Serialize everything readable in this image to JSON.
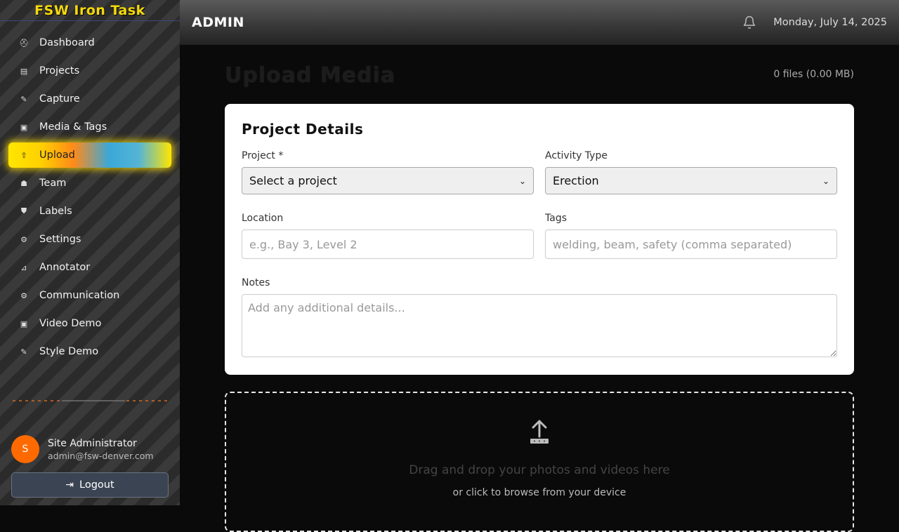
{
  "app": {
    "brand": "FSW Iron Task"
  },
  "sidebar": {
    "items": [
      {
        "label": "Dashboard",
        "icon": "helmet-icon",
        "glyph": "⛑"
      },
      {
        "label": "Projects",
        "icon": "folder-icon",
        "glyph": "▤"
      },
      {
        "label": "Capture",
        "icon": "pencil-icon",
        "glyph": "✎"
      },
      {
        "label": "Media & Tags",
        "icon": "image-icon",
        "glyph": "▣"
      },
      {
        "label": "Upload",
        "icon": "upload-icon",
        "glyph": "⇧"
      },
      {
        "label": "Team",
        "icon": "team-icon",
        "glyph": "☗"
      },
      {
        "label": "Labels",
        "icon": "labels-icon",
        "glyph": "⛊"
      },
      {
        "label": "Settings",
        "icon": "gear-icon",
        "glyph": "⚙"
      },
      {
        "label": "Annotator",
        "icon": "ruler-icon",
        "glyph": "⊿"
      },
      {
        "label": "Communication",
        "icon": "gear-icon",
        "glyph": "⚙"
      },
      {
        "label": "Video Demo",
        "icon": "image-icon",
        "glyph": "▣"
      },
      {
        "label": "Style Demo",
        "icon": "pencil-icon",
        "glyph": "✎"
      }
    ],
    "active_index": 4,
    "user": {
      "initial": "S",
      "name": "Site Administrator",
      "email": "admin@fsw-denver.com"
    },
    "logout_label": "Logout"
  },
  "topbar": {
    "title": "ADMIN",
    "date": "Monday, July 14, 2025"
  },
  "main": {
    "page_title": "Upload Media",
    "file_count": "0 files (0.00 MB)",
    "card": {
      "title": "Project Details",
      "project_label": "Project *",
      "project_value": "Select a project",
      "activity_label": "Activity Type",
      "activity_value": "Erection",
      "location_label": "Location",
      "location_placeholder": "e.g., Bay 3, Level 2",
      "tags_label": "Tags",
      "tags_placeholder": "welding, beam, safety (comma separated)",
      "notes_label": "Notes",
      "notes_placeholder": "Add any additional details..."
    },
    "dropzone": {
      "text": "Drag and drop your photos and videos here",
      "subtext": "or click to browse from your device"
    }
  },
  "colors": {
    "accent_yellow": "#f5d90a",
    "avatar_orange": "#ff6a00"
  }
}
